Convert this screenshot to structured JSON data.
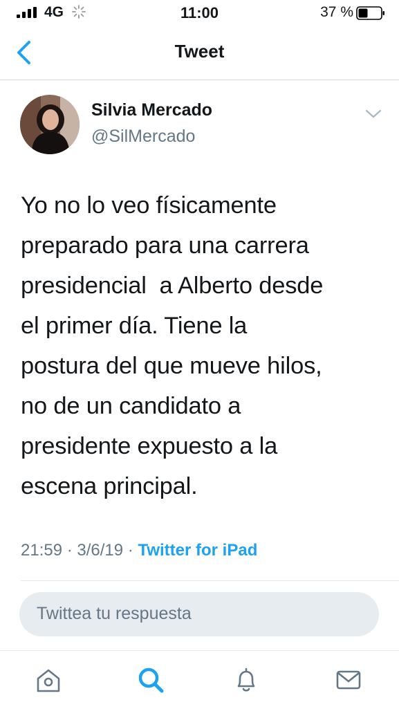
{
  "status_bar": {
    "network": "4G",
    "time": "11:00",
    "battery_percent": "37 %",
    "icons": [
      "signal-icon",
      "activity-spinner-icon",
      "battery-icon"
    ]
  },
  "nav": {
    "title": "Tweet",
    "back_icon": "chevron-left-icon"
  },
  "tweet": {
    "author_name": "Silvia Mercado",
    "author_handle": "@SilMercado",
    "text_lines": [
      "Yo no lo veo físicamente",
      "preparado para una carrera",
      "presidencial  a Alberto desde",
      "el primer día. Tiene la",
      "postura del que mueve hilos,",
      "no de un candidato a",
      "presidente expuesto a la",
      "escena principal."
    ],
    "time": "21:59",
    "separator": " · ",
    "date": "3/6/19",
    "source": "Twitter for iPad"
  },
  "reply": {
    "placeholder": "Twittea tu respuesta"
  },
  "tab_bar": {
    "tabs": [
      "home-icon",
      "search-icon",
      "notifications-bell-icon",
      "messages-envelope-icon"
    ]
  },
  "colors": {
    "accent": "#1da1f2",
    "text_primary": "#14171a",
    "text_secondary": "#657786",
    "reply_box_bg": "#e6ecf0"
  }
}
